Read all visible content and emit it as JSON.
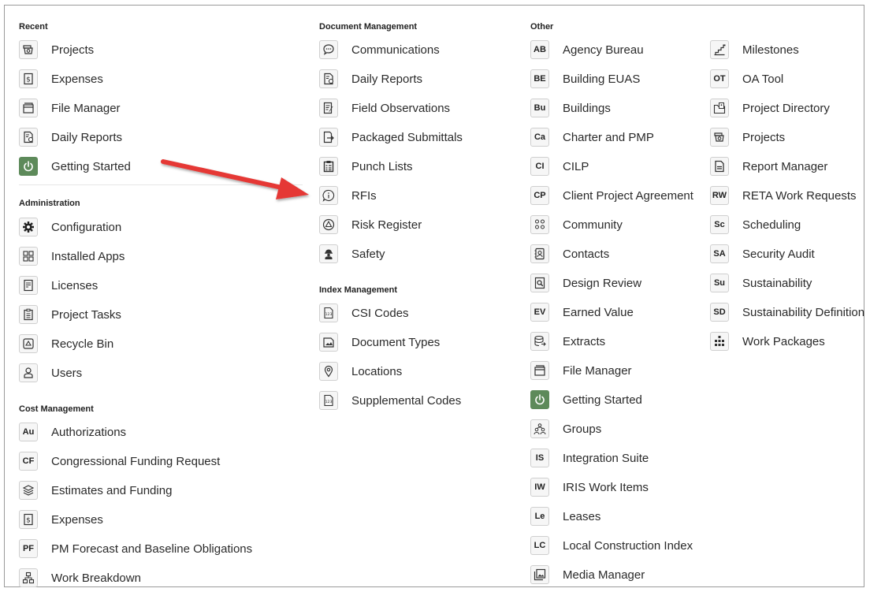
{
  "sections": {
    "recent": {
      "title": "Recent",
      "items": [
        {
          "label": "Projects",
          "icon": "projects-icon"
        },
        {
          "label": "Expenses",
          "icon": "dollar-doc-icon"
        },
        {
          "label": "File Manager",
          "icon": "file-manager-icon"
        },
        {
          "label": "Daily Reports",
          "icon": "daily-report-icon"
        },
        {
          "label": "Getting Started",
          "icon": "power-icon"
        }
      ]
    },
    "administration": {
      "title": "Administration",
      "items": [
        {
          "label": "Configuration",
          "icon": "gear-icon"
        },
        {
          "label": "Installed Apps",
          "icon": "apps-icon"
        },
        {
          "label": "Licenses",
          "icon": "license-icon"
        },
        {
          "label": "Project Tasks",
          "icon": "clipboard-icon"
        },
        {
          "label": "Recycle Bin",
          "icon": "recycle-icon"
        },
        {
          "label": "Users",
          "icon": "user-icon"
        }
      ]
    },
    "cost": {
      "title": "Cost Management",
      "items": [
        {
          "label": "Authorizations",
          "badge": "Au"
        },
        {
          "label": "Congressional Funding Request",
          "badge": "CF"
        },
        {
          "label": "Estimates and Funding",
          "icon": "layers-icon"
        },
        {
          "label": "Expenses",
          "icon": "dollar-doc-icon"
        },
        {
          "label": "PM Forecast and Baseline Obligations",
          "badge": "PF"
        },
        {
          "label": "Work Breakdown",
          "icon": "hierarchy-icon"
        }
      ]
    },
    "document": {
      "title": "Document Management",
      "items": [
        {
          "label": "Communications",
          "icon": "chat-bubble-icon"
        },
        {
          "label": "Daily Reports",
          "icon": "daily-report-icon"
        },
        {
          "label": "Field Observations",
          "icon": "edit-doc-icon"
        },
        {
          "label": "Packaged Submittals",
          "icon": "submit-doc-icon"
        },
        {
          "label": "Punch Lists",
          "icon": "punch-list-icon"
        },
        {
          "label": "RFIs",
          "icon": "info-bubble-icon"
        },
        {
          "label": "Risk Register",
          "icon": "warning-icon"
        },
        {
          "label": "Safety",
          "icon": "safety-worker-icon"
        }
      ]
    },
    "index": {
      "title": "Index Management",
      "items": [
        {
          "label": "CSI Codes",
          "icon": "code-doc-icon"
        },
        {
          "label": "Document Types",
          "icon": "doc-image-icon"
        },
        {
          "label": "Locations",
          "icon": "location-pin-icon"
        },
        {
          "label": "Supplemental Codes",
          "icon": "code-doc-icon"
        }
      ]
    },
    "other": {
      "title": "Other",
      "col1": [
        {
          "label": "Agency Bureau",
          "badge": "AB"
        },
        {
          "label": "Building EUAS",
          "badge": "BE"
        },
        {
          "label": "Buildings",
          "badge": "Bu"
        },
        {
          "label": "Charter and PMP",
          "badge": "Ca"
        },
        {
          "label": "CILP",
          "badge": "CI"
        },
        {
          "label": "Client Project Agreement",
          "badge": "CP"
        },
        {
          "label": "Community",
          "icon": "community-icon"
        },
        {
          "label": "Contacts",
          "icon": "contacts-icon"
        },
        {
          "label": "Design Review",
          "icon": "design-review-icon"
        },
        {
          "label": "Earned Value",
          "badge": "EV"
        },
        {
          "label": "Extracts",
          "icon": "database-icon"
        },
        {
          "label": "File Manager",
          "icon": "file-manager-icon"
        },
        {
          "label": "Getting Started",
          "icon": "power-icon"
        },
        {
          "label": "Groups",
          "icon": "groups-icon"
        },
        {
          "label": "Integration Suite",
          "badge": "IS"
        },
        {
          "label": "IRIS Work Items",
          "badge": "IW"
        },
        {
          "label": "Leases",
          "badge": "Le"
        },
        {
          "label": "Local Construction Index",
          "badge": "LC"
        },
        {
          "label": "Media Manager",
          "icon": "media-icon"
        }
      ],
      "col2": [
        {
          "label": "Milestones",
          "icon": "milestone-icon"
        },
        {
          "label": "OA Tool",
          "badge": "OT"
        },
        {
          "label": "Project Directory",
          "icon": "directory-icon"
        },
        {
          "label": "Projects",
          "icon": "projects-icon"
        },
        {
          "label": "Report Manager",
          "icon": "report-icon"
        },
        {
          "label": "RETA Work Requests",
          "badge": "RW"
        },
        {
          "label": "Scheduling",
          "badge": "Sc"
        },
        {
          "label": "Security Audit",
          "badge": "SA"
        },
        {
          "label": "Sustainability",
          "badge": "Su"
        },
        {
          "label": "Sustainability Definition",
          "badge": "SD"
        },
        {
          "label": "Work Packages",
          "icon": "work-packages-icon"
        }
      ]
    }
  },
  "annotation": {
    "type": "red-arrow",
    "points_to": "RFIs",
    "color": "#e53935"
  }
}
